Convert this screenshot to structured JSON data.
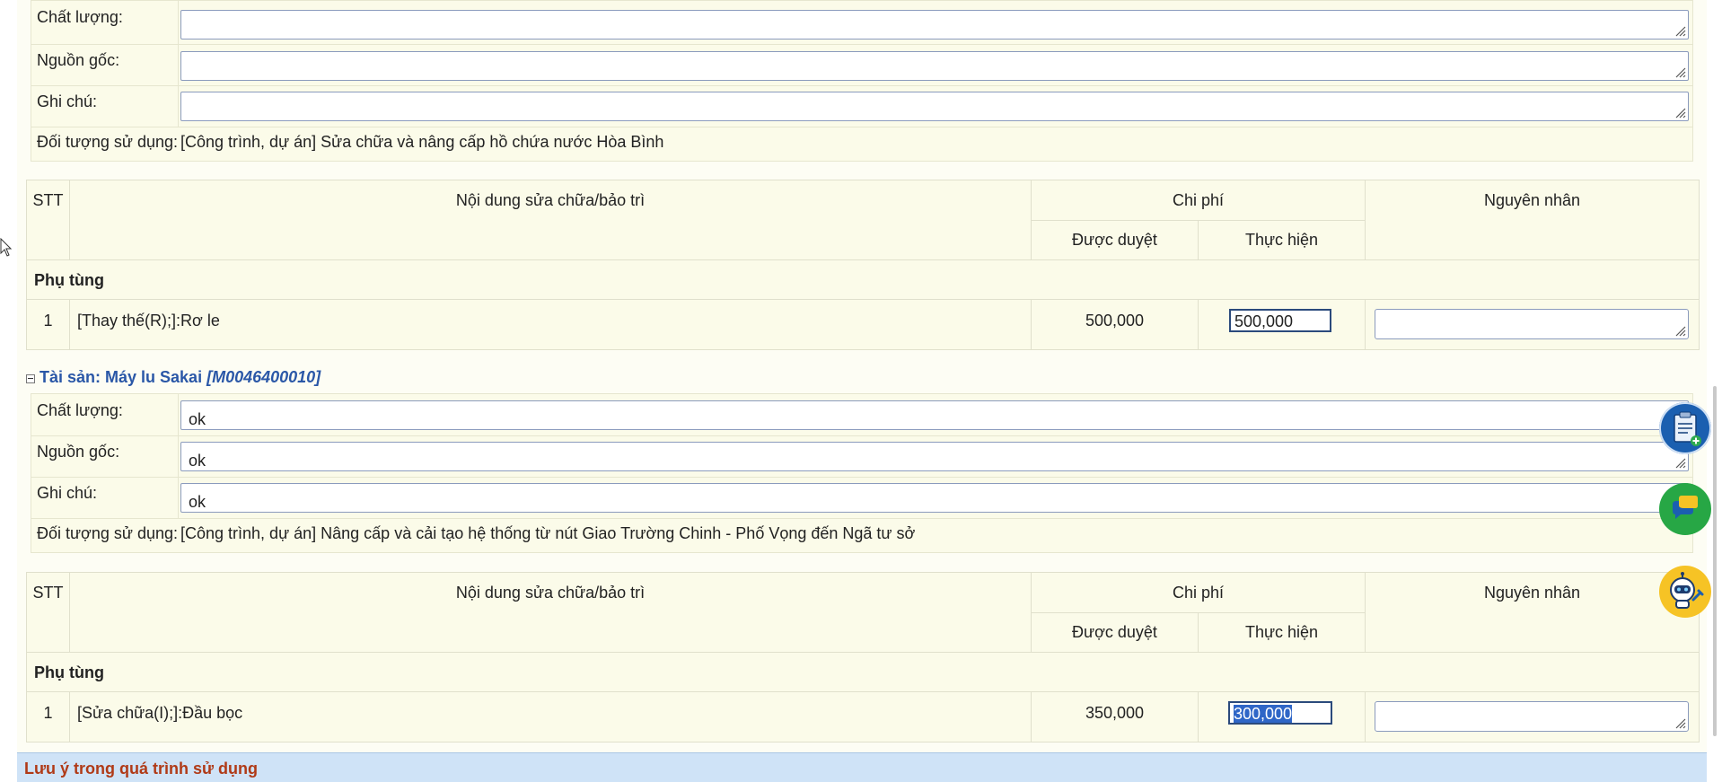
{
  "asset1": {
    "quality_label": "Chất lượng:",
    "quality_value": "",
    "origin_label": "Nguồn gốc:",
    "origin_value": "",
    "note_label": "Ghi chú:",
    "note_value": "",
    "use_label": "Đối tượng sử dụng:",
    "use_value": "[Công trình, dự án] Sửa chữa và nâng cấp hồ chứa nước Hòa Bình"
  },
  "table1": {
    "headers": {
      "stt": "STT",
      "content": "Nội dung sửa chữa/bảo trì",
      "cost": "Chi phí",
      "approved": "Được duyệt",
      "actual": "Thực hiện",
      "reason": "Nguyên nhân"
    },
    "group": "Phụ tùng",
    "rows": [
      {
        "stt": "1",
        "content": "[Thay thế(R);]:Rơ le",
        "approved": "500,000",
        "actual": "500,000",
        "reason": ""
      }
    ]
  },
  "asset2": {
    "title_prefix": "Tài sản: Máy lu Sakai ",
    "code": "[M0046400010]",
    "quality_label": "Chất lượng:",
    "quality_value": "ok",
    "origin_label": "Nguồn gốc:",
    "origin_value": "ok",
    "note_label": "Ghi chú:",
    "note_value": "ok",
    "use_label": "Đối tượng sử dụng:",
    "use_value": "[Công trình, dự án] Nâng cấp và cải tạo hệ thống từ nút Giao Trường Chinh - Phố Vọng đến Ngã tư sở"
  },
  "table2": {
    "headers": {
      "stt": "STT",
      "content": "Nội dung sửa chữa/bảo trì",
      "cost": "Chi phí",
      "approved": "Được duyệt",
      "actual": "Thực hiện",
      "reason": "Nguyên nhân"
    },
    "group": "Phụ tùng",
    "rows": [
      {
        "stt": "1",
        "content": "[Sửa chữa(I);]:Đầu bọc",
        "approved": "350,000",
        "actual": "300,000",
        "reason": ""
      }
    ]
  },
  "footer": {
    "title": "Lưu ý trong quá trình sử dụng"
  },
  "fabs": {
    "clipboard": "clipboard-add-icon",
    "chat": "chat-icon",
    "robot": "robot-support-icon"
  },
  "colors": {
    "panel_bg": "#fbfbe9",
    "section_title": "#2a57a7",
    "footer_bg": "#cfe3f7",
    "footer_text": "#b03a17",
    "fab_blue": "#1b5fb0",
    "fab_green": "#27a745",
    "fab_yellow": "#f6c325"
  }
}
